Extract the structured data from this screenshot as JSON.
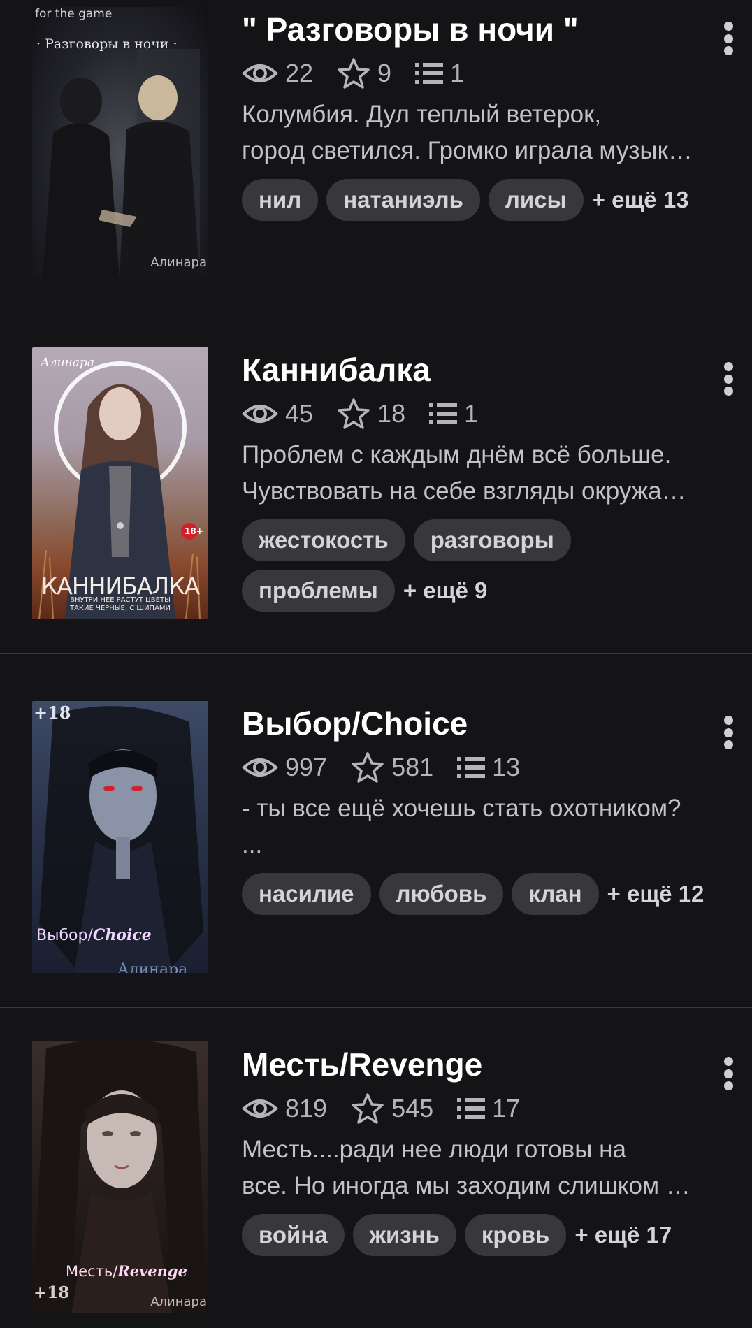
{
  "stories": [
    {
      "title": "\" Разговоры в ночи \"",
      "views": "22",
      "stars": "9",
      "chapters": "1",
      "desc_lines": [
        "Колумбия. Дул теплый ветерок,",
        "город светился. Громко играла музык…"
      ],
      "tags": [
        "нил",
        "натаниэль",
        "лисы"
      ],
      "more": "+ ещё 13",
      "cover": {
        "top": "for the game",
        "title": "· Разговоры в ночи ·",
        "author": "Алинара"
      }
    },
    {
      "title": "Каннибалка",
      "views": "45",
      "stars": "18",
      "chapters": "1",
      "desc_lines": [
        "Проблем с каждым днём всё больше.",
        "Чувствовать на себе взгляды окружа…"
      ],
      "tags": [
        "жестокость",
        "разговоры",
        "проблемы"
      ],
      "more": "+ ещё 9",
      "cover": {
        "author": "Алинара",
        "title": "КАННИБАЛКА",
        "subtitle": "ВНУТРИ НЕЕ РАСТУТ ЦВЕТЫ ТАКИЕ ЧЕРНЫЕ, С ШИПАМИ",
        "age": "18+"
      }
    },
    {
      "title": "Выбор/Choice",
      "views": "997",
      "stars": "581",
      "chapters": "13",
      "desc_lines": [
        "- ты все ещё хочешь стать охотником?",
        "..."
      ],
      "tags": [
        "насилие",
        "любовь",
        "клан"
      ],
      "more": "+ ещё 12",
      "cover": {
        "age": "+18",
        "title_a": "Выбор/",
        "title_b": "Choice",
        "author": "Алинара"
      }
    },
    {
      "title": "Месть/Revenge",
      "views": "819",
      "stars": "545",
      "chapters": "17",
      "desc_lines": [
        "Месть....ради нее люди готовы на",
        "все. Но иногда мы заходим слишком …"
      ],
      "tags": [
        "война",
        "жизнь",
        "кровь"
      ],
      "more": "+ ещё 17",
      "cover": {
        "title_a": "Месть/",
        "title_b": "Revenge",
        "age": "+18",
        "author": "Алинара"
      }
    }
  ],
  "colors": {
    "background": "#141316",
    "tag_bg": "#38373b",
    "stat_text": "#b5b4b8"
  },
  "icons": [
    "eye-icon",
    "star-icon",
    "list-icon",
    "more-vertical-icon"
  ]
}
